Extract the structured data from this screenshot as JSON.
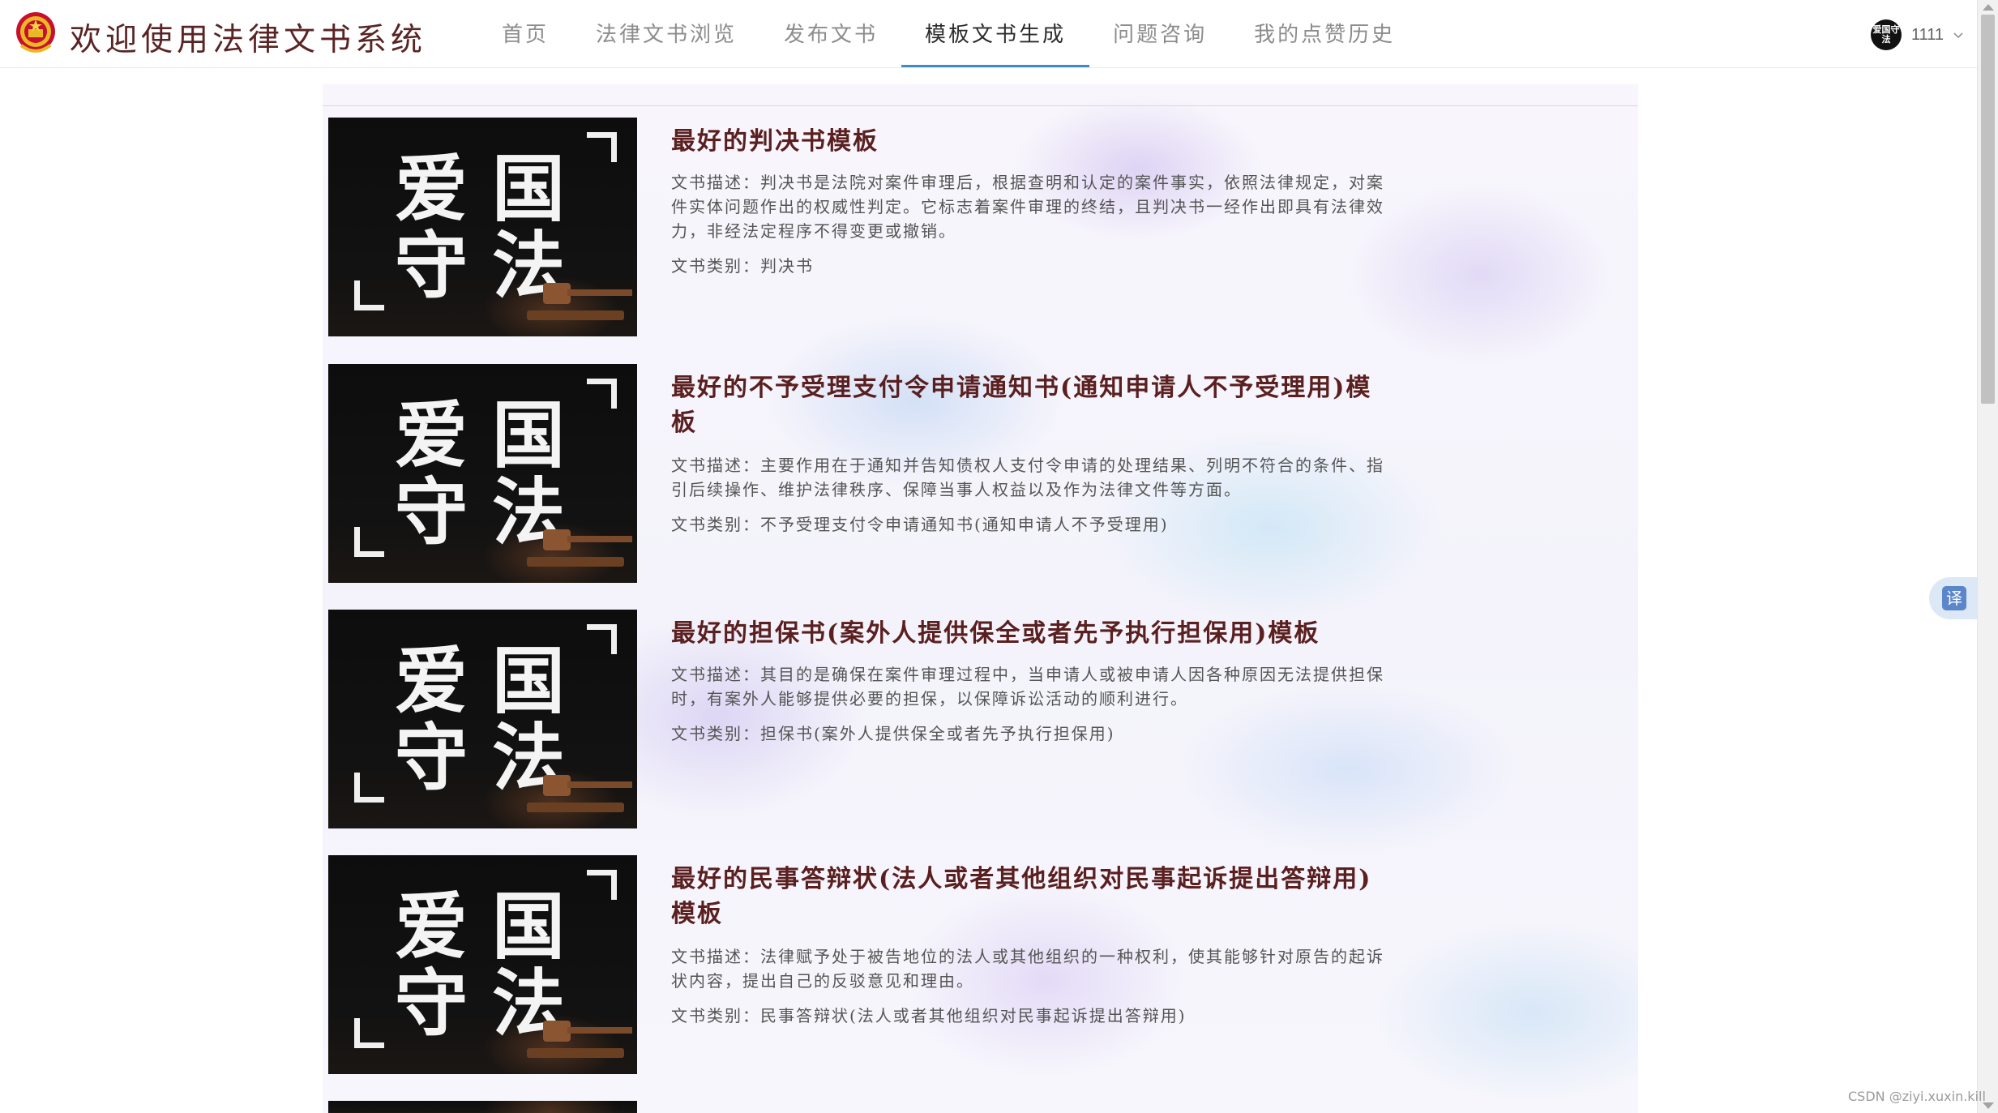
{
  "header": {
    "site_title": "欢迎使用法律文书系统",
    "nav": [
      {
        "label": "首页",
        "active": false
      },
      {
        "label": "法律文书浏览",
        "active": false
      },
      {
        "label": "发布文书",
        "active": false
      },
      {
        "label": "模板文书生成",
        "active": true
      },
      {
        "label": "问题咨询",
        "active": false
      },
      {
        "label": "我的点赞历史",
        "active": false
      }
    ],
    "user": {
      "avatar_text": "爱国守法",
      "username": "1111"
    }
  },
  "thumbnail": {
    "chars": [
      "爱",
      "国",
      "守",
      "法"
    ]
  },
  "documents": [
    {
      "title": "最好的判决书模板",
      "description": "文书描述：判决书是法院对案件审理后，根据查明和认定的案件事实，依照法律规定，对案件实体问题作出的权威性判定。它标志着案件审理的终结，且判决书一经作出即具有法律效力，非经法定程序不得变更或撤销。",
      "category": "文书类别：判决书"
    },
    {
      "title": "最好的不予受理支付令申请通知书(通知申请人不予受理用)模板",
      "description": "文书描述：主要作用在于通知并告知债权人支付令申请的处理结果、列明不符合的条件、指引后续操作、维护法律秩序、保障当事人权益以及作为法律文件等方面。",
      "category": "文书类别：不予受理支付令申请通知书(通知申请人不予受理用)"
    },
    {
      "title": "最好的担保书(案外人提供保全或者先予执行担保用)模板",
      "description": "文书描述：其目的是确保在案件审理过程中，当申请人或被申请人因各种原因无法提供担保时，有案外人能够提供必要的担保，以保障诉讼活动的顺利进行。",
      "category": "文书类别：担保书(案外人提供保全或者先予执行担保用)"
    },
    {
      "title": "最好的民事答辩状(法人或者其他组织对民事起诉提出答辩用)模板",
      "description": "文书描述：法律赋予处于被告地位的法人或其他组织的一种权利，使其能够针对原告的起诉状内容，提出自己的反驳意见和理由。",
      "category": "文书类别：民事答辩状(法人或者其他组织对民事起诉提出答辩用)"
    }
  ],
  "floating": {
    "translate_label": "译"
  },
  "watermark": "CSDN @ziyi.xuxin.kill",
  "colors": {
    "title": "#5a1f1f",
    "site_title": "#5a2424",
    "nav_active_underline": "#3f8ccd",
    "nav_text": "#8c8c8c"
  }
}
